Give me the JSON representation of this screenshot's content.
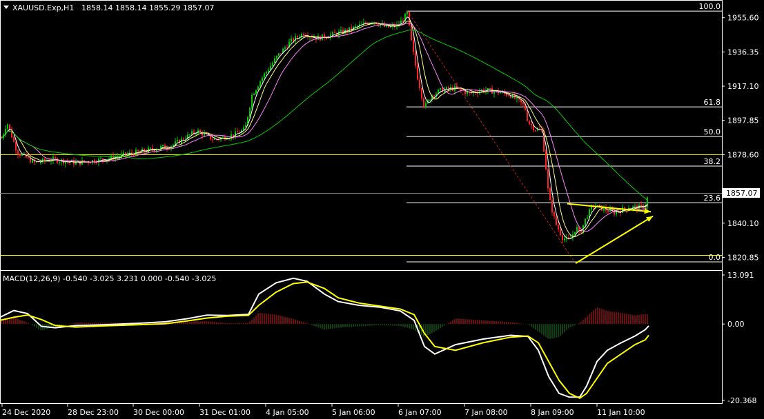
{
  "header": {
    "symbol": "XAUUSD.Exp,H1",
    "ohlc": "1858.14 1858.14 1855.29 1857.07"
  },
  "macd_header": "MACD(12,26,9) -0.540 -3.025 3.231 0.000 -0.540 -3.025",
  "current_price_label": "1857.07",
  "colors": {
    "background": "#000000",
    "bull": "#00cc00",
    "bear": "#ff2020",
    "ma_fast": "#ffffff",
    "ma_mid": "#ffff80",
    "ma_slow": "#ff80ff",
    "ma_long": "#00cc00",
    "fib": "#ffffff",
    "hline": "#ffff00",
    "arrows": "#ffff00",
    "macd_line": "#ffffff",
    "signal_line": "#ffff00",
    "hist_pos": "#cc2020",
    "hist_neg": "#208020"
  },
  "chart_data": [
    {
      "type": "candlestick",
      "title": "XAUUSD.Exp,H1",
      "y_ticks": [
        "1955.60",
        "1936.35",
        "1917.10",
        "1897.85",
        "1878.60",
        "1840.10",
        "1820.85"
      ],
      "ylim": [
        1816,
        1964
      ],
      "x_ticks": [
        "24 Dec 2020",
        "28 Dec 23:00",
        "30 Dec 00:00",
        "31 Dec 01:00",
        "4 Jan 05:00",
        "5 Jan 06:00",
        "6 Jan 07:00",
        "7 Jan 08:00",
        "8 Jan 09:00",
        "11 Jan 10:00"
      ],
      "last_price": 1857.07,
      "fibonacci": {
        "high": 1959.5,
        "low": 1818.5,
        "levels": [
          {
            "label": "100.0",
            "ratio": 1.0
          },
          {
            "label": "61.8",
            "ratio": 0.618
          },
          {
            "label": "50.0",
            "ratio": 0.5
          },
          {
            "label": "38.2",
            "ratio": 0.382
          },
          {
            "label": "23.6",
            "ratio": 0.236
          },
          {
            "label": "0.0",
            "ratio": 0.0
          }
        ]
      },
      "horizontal_lines": [
        1878.8,
        1822.2
      ],
      "price_anchors": [
        [
          0,
          1888
        ],
        [
          3,
          1888
        ],
        [
          10,
          1897
        ],
        [
          25,
          1880
        ],
        [
          50,
          1874
        ],
        [
          75,
          1876
        ],
        [
          110,
          1874
        ],
        [
          150,
          1876
        ],
        [
          200,
          1880
        ],
        [
          250,
          1884
        ],
        [
          285,
          1892
        ],
        [
          310,
          1887
        ],
        [
          340,
          1890
        ],
        [
          355,
          1893
        ],
        [
          365,
          1912
        ],
        [
          380,
          1922
        ],
        [
          400,
          1933
        ],
        [
          420,
          1942
        ],
        [
          440,
          1947
        ],
        [
          460,
          1944
        ],
        [
          480,
          1946
        ],
        [
          500,
          1948
        ],
        [
          520,
          1951
        ],
        [
          540,
          1954
        ],
        [
          560,
          1950
        ],
        [
          575,
          1951
        ],
        [
          585,
          1955
        ],
        [
          590,
          1958
        ],
        [
          596,
          1942
        ],
        [
          605,
          1922
        ],
        [
          615,
          1905
        ],
        [
          625,
          1912
        ],
        [
          640,
          1915
        ],
        [
          660,
          1916
        ],
        [
          680,
          1913
        ],
        [
          700,
          1915
        ],
        [
          720,
          1914
        ],
        [
          740,
          1912
        ],
        [
          760,
          1906
        ],
        [
          765,
          1897
        ],
        [
          775,
          1893
        ],
        [
          785,
          1892
        ],
        [
          790,
          1875
        ],
        [
          795,
          1855
        ],
        [
          805,
          1840
        ],
        [
          815,
          1832
        ],
        [
          825,
          1830
        ],
        [
          835,
          1838
        ],
        [
          840,
          1834
        ],
        [
          850,
          1844
        ],
        [
          860,
          1850
        ],
        [
          875,
          1848
        ],
        [
          890,
          1846
        ],
        [
          910,
          1849
        ],
        [
          925,
          1849
        ],
        [
          935,
          1850
        ],
        [
          940,
          1857
        ]
      ]
    },
    {
      "type": "line",
      "title": "MACD(12,26,9)",
      "y_ticks": [
        "13.091",
        "0.00",
        "-20.368"
      ],
      "ylim": [
        -20.368,
        13.091
      ],
      "series": [
        {
          "name": "MACD",
          "points": [
            [
              0,
              1.8
            ],
            [
              20,
              3.6
            ],
            [
              40,
              2.8
            ],
            [
              60,
              -0.6
            ],
            [
              80,
              -1.0
            ],
            [
              110,
              -0.4
            ],
            [
              150,
              -0.2
            ],
            [
              200,
              0.2
            ],
            [
              240,
              0.6
            ],
            [
              270,
              1.4
            ],
            [
              300,
              2.4
            ],
            [
              330,
              2.3
            ],
            [
              360,
              2.6
            ],
            [
              375,
              8.0
            ],
            [
              400,
              11.0
            ],
            [
              425,
              12.2
            ],
            [
              445,
              11.4
            ],
            [
              470,
              8.0
            ],
            [
              490,
              6.0
            ],
            [
              520,
              5.0
            ],
            [
              550,
              4.5
            ],
            [
              580,
              3.5
            ],
            [
              600,
              1.0
            ],
            [
              615,
              -6.0
            ],
            [
              630,
              -8.0
            ],
            [
              660,
              -5.5
            ],
            [
              700,
              -4.0
            ],
            [
              740,
              -3.0
            ],
            [
              765,
              -3.3
            ],
            [
              780,
              -7.0
            ],
            [
              795,
              -14.0
            ],
            [
              810,
              -18.5
            ],
            [
              825,
              -19.5
            ],
            [
              840,
              -19.5
            ],
            [
              850,
              -16.5
            ],
            [
              865,
              -10.0
            ],
            [
              880,
              -7.0
            ],
            [
              900,
              -5.0
            ],
            [
              920,
              -3.2
            ],
            [
              935,
              -1.5
            ],
            [
              940,
              -0.5
            ]
          ]
        },
        {
          "name": "Signal",
          "points": [
            [
              0,
              1.0
            ],
            [
              20,
              1.8
            ],
            [
              40,
              2.4
            ],
            [
              60,
              1.2
            ],
            [
              80,
              -0.4
            ],
            [
              110,
              -0.8
            ],
            [
              150,
              -0.5
            ],
            [
              200,
              -0.2
            ],
            [
              240,
              0.1
            ],
            [
              270,
              0.8
            ],
            [
              300,
              1.6
            ],
            [
              330,
              2.1
            ],
            [
              360,
              2.3
            ],
            [
              375,
              5.0
            ],
            [
              400,
              8.5
            ],
            [
              425,
              10.8
            ],
            [
              445,
              11.2
            ],
            [
              470,
              9.5
            ],
            [
              490,
              7.0
            ],
            [
              520,
              5.6
            ],
            [
              550,
              4.8
            ],
            [
              580,
              4.0
            ],
            [
              600,
              2.5
            ],
            [
              615,
              -2.5
            ],
            [
              630,
              -6.0
            ],
            [
              660,
              -7.0
            ],
            [
              700,
              -5.0
            ],
            [
              740,
              -3.5
            ],
            [
              765,
              -3.2
            ],
            [
              780,
              -5.0
            ],
            [
              795,
              -10.0
            ],
            [
              810,
              -15.0
            ],
            [
              825,
              -18.5
            ],
            [
              840,
              -19.8
            ],
            [
              850,
              -18.5
            ],
            [
              865,
              -14.5
            ],
            [
              880,
              -10.5
            ],
            [
              900,
              -8.0
            ],
            [
              920,
              -5.5
            ],
            [
              935,
              -4.2
            ],
            [
              940,
              -3.0
            ]
          ]
        }
      ],
      "histogram": [
        [
          0,
          0.8
        ],
        [
          20,
          1.8
        ],
        [
          40,
          0.4
        ],
        [
          60,
          -1.8
        ],
        [
          80,
          -0.6
        ],
        [
          110,
          0.4
        ],
        [
          150,
          0.3
        ],
        [
          200,
          0.4
        ],
        [
          240,
          0.5
        ],
        [
          270,
          0.6
        ],
        [
          300,
          0.8
        ],
        [
          330,
          0.2
        ],
        [
          360,
          0.3
        ],
        [
          375,
          3.0
        ],
        [
          400,
          2.5
        ],
        [
          425,
          1.4
        ],
        [
          445,
          0.2
        ],
        [
          470,
          -1.5
        ],
        [
          490,
          -1.0
        ],
        [
          520,
          -0.6
        ],
        [
          550,
          -0.3
        ],
        [
          580,
          -0.5
        ],
        [
          600,
          -1.5
        ],
        [
          615,
          -3.5
        ],
        [
          630,
          -2.0
        ],
        [
          660,
          1.5
        ],
        [
          700,
          1.0
        ],
        [
          740,
          0.5
        ],
        [
          765,
          -0.1
        ],
        [
          780,
          -2.0
        ],
        [
          795,
          -4.0
        ],
        [
          810,
          -3.5
        ],
        [
          825,
          -1.0
        ],
        [
          840,
          0.3
        ],
        [
          850,
          2.0
        ],
        [
          865,
          4.5
        ],
        [
          880,
          3.5
        ],
        [
          900,
          3.0
        ],
        [
          920,
          2.3
        ],
        [
          935,
          2.7
        ],
        [
          940,
          2.5
        ]
      ]
    }
  ]
}
